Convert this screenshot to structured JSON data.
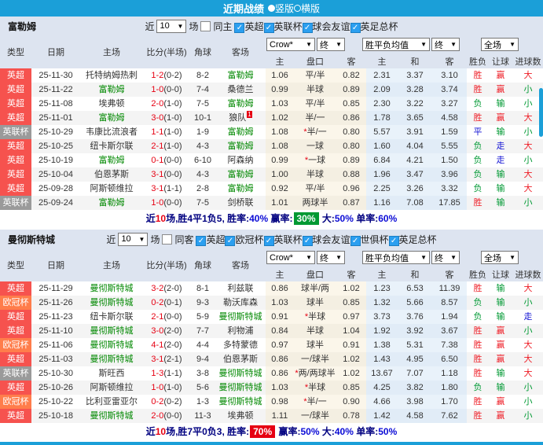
{
  "titlebar": {
    "title": "近期战绩",
    "layout_options": [
      {
        "label": "竖版",
        "selected": true
      },
      {
        "label": "横版",
        "selected": false
      }
    ]
  },
  "table_headers": {
    "type": "类型",
    "date": "日期",
    "home": "主场",
    "score": "比分(半场)",
    "corner": "角球",
    "away": "客场",
    "odds_home": "主",
    "odds_handicap": "盘口",
    "odds_away": "客",
    "avg_home": "主",
    "avg_draw": "和",
    "avg_away": "客",
    "result": "胜负",
    "handicap_result": "让球",
    "goals_result": "进球数"
  },
  "type_colors": {
    "英超": "#f6524e",
    "英联杯": "#9a9a9a",
    "欧冠杯": "#ff7d4b"
  },
  "result_colors": {
    "胜": "#ee1c25",
    "负": "#009933",
    "平": "#1414d4",
    "赢": "#ee1c25",
    "输": "#009933",
    "走": "#1414d4",
    "大": "#ee1c25",
    "小": "#009933"
  },
  "sections": [
    {
      "team": "富勒姆",
      "filter": {
        "near_label": "近",
        "count": "10",
        "games_label": "场",
        "venue_label": "同主",
        "venue_checked": false,
        "competitions": [
          "英超",
          "英联杯",
          "球会友谊",
          "英足总杯"
        ]
      },
      "dropdowns": {
        "odds_source": "Crow*",
        "odds_stage": "终",
        "avg_label": "胜平负均值",
        "avg_stage": "终",
        "scope": "全场"
      },
      "rows": [
        {
          "type": "英超",
          "date": "25-11-30",
          "home": "托特纳姆热刺",
          "home_focus": false,
          "score": "1-2",
          "half": "(0-2)",
          "corner": "8-2",
          "away": "富勒姆",
          "away_focus": true,
          "o1": "1.06",
          "pk": "平/半",
          "pk_star": false,
          "o2": "0.82",
          "a1": "2.31",
          "a2": "3.37",
          "a3": "3.10",
          "r1": "胜",
          "r2": "赢",
          "r3": "大"
        },
        {
          "type": "英超",
          "date": "25-11-22",
          "home": "富勒姆",
          "home_focus": true,
          "score": "1-0",
          "half": "(0-0)",
          "corner": "7-4",
          "away": "桑德兰",
          "away_focus": false,
          "o1": "0.99",
          "pk": "半球",
          "pk_star": false,
          "o2": "0.89",
          "a1": "2.09",
          "a2": "3.28",
          "a3": "3.74",
          "r1": "胜",
          "r2": "赢",
          "r3": "小"
        },
        {
          "type": "英超",
          "date": "25-11-08",
          "home": "埃弗顿",
          "home_focus": false,
          "score": "2-0",
          "half": "(1-0)",
          "corner": "7-5",
          "away": "富勒姆",
          "away_focus": true,
          "o1": "1.03",
          "pk": "平/半",
          "pk_star": false,
          "o2": "0.85",
          "a1": "2.30",
          "a2": "3.22",
          "a3": "3.27",
          "r1": "负",
          "r2": "输",
          "r3": "小"
        },
        {
          "type": "英超",
          "date": "25-11-01",
          "home": "富勒姆",
          "home_focus": true,
          "score": "3-0",
          "half": "(1-0)",
          "corner": "10-1",
          "away": "狼队",
          "away_focus": false,
          "away_redcard": "1",
          "o1": "1.02",
          "pk": "半/一",
          "pk_star": false,
          "o2": "0.86",
          "a1": "1.78",
          "a2": "3.65",
          "a3": "4.58",
          "r1": "胜",
          "r2": "赢",
          "r3": "大"
        },
        {
          "type": "英联杯",
          "date": "25-10-29",
          "home": "韦康比流浪者",
          "home_focus": false,
          "score": "1-1",
          "half": "(1-0)",
          "corner": "1-9",
          "away": "富勒姆",
          "away_focus": true,
          "o1": "1.08",
          "pk": "半/一",
          "pk_star": true,
          "o2": "0.80",
          "a1": "5.57",
          "a2": "3.91",
          "a3": "1.59",
          "r1": "平",
          "r2": "输",
          "r3": "小"
        },
        {
          "type": "英超",
          "date": "25-10-25",
          "home": "纽卡斯尔联",
          "home_focus": false,
          "score": "2-1",
          "half": "(1-0)",
          "corner": "4-3",
          "away": "富勒姆",
          "away_focus": true,
          "o1": "1.08",
          "pk": "一球",
          "pk_star": false,
          "o2": "0.80",
          "a1": "1.60",
          "a2": "4.04",
          "a3": "5.55",
          "r1": "负",
          "r2": "走",
          "r3": "大"
        },
        {
          "type": "英超",
          "date": "25-10-19",
          "home": "富勒姆",
          "home_focus": true,
          "score": "0-1",
          "half": "(0-0)",
          "corner": "6-10",
          "away": "阿森纳",
          "away_focus": false,
          "o1": "0.99",
          "pk": "一球",
          "pk_star": true,
          "o2": "0.89",
          "a1": "6.84",
          "a2": "4.21",
          "a3": "1.50",
          "r1": "负",
          "r2": "走",
          "r3": "小"
        },
        {
          "type": "英超",
          "date": "25-10-04",
          "home": "伯恩茅斯",
          "home_focus": false,
          "score": "3-1",
          "half": "(0-0)",
          "corner": "4-3",
          "away": "富勒姆",
          "away_focus": true,
          "o1": "1.00",
          "pk": "半球",
          "pk_star": false,
          "o2": "0.88",
          "a1": "1.96",
          "a2": "3.47",
          "a3": "3.96",
          "r1": "负",
          "r2": "输",
          "r3": "大"
        },
        {
          "type": "英超",
          "date": "25-09-28",
          "home": "阿斯顿维拉",
          "home_focus": false,
          "score": "3-1",
          "half": "(1-1)",
          "corner": "2-8",
          "away": "富勒姆",
          "away_focus": true,
          "o1": "0.92",
          "pk": "平/半",
          "pk_star": false,
          "o2": "0.96",
          "a1": "2.25",
          "a2": "3.26",
          "a3": "3.32",
          "r1": "负",
          "r2": "输",
          "r3": "大"
        },
        {
          "type": "英联杯",
          "date": "25-09-24",
          "home": "富勒姆",
          "home_focus": true,
          "score": "1-0",
          "half": "(0-0)",
          "corner": "7-5",
          "away": "剑桥联",
          "away_focus": false,
          "o1": "1.01",
          "pk": "两球半",
          "pk_star": false,
          "o2": "0.87",
          "a1": "1.16",
          "a2": "7.08",
          "a3": "17.85",
          "r1": "胜",
          "r2": "输",
          "r3": "小"
        }
      ],
      "summary": {
        "lead": "近",
        "count": "10",
        "tail": "场,胜4平1负5, 胜率:",
        "items": [
          {
            "label": "",
            "value": "40%",
            "style": "blue"
          },
          {
            "label": " 赢率:",
            "value": "30%",
            "style": "green-bg"
          },
          {
            "label": " 大:",
            "value": "50%",
            "style": "blue"
          },
          {
            "label": " 单率:",
            "value": "60%",
            "style": "blue"
          }
        ]
      }
    },
    {
      "team": "曼彻斯特城",
      "filter": {
        "near_label": "近",
        "count": "10",
        "games_label": "场",
        "venue_label": "同客",
        "venue_checked": false,
        "competitions": [
          "英超",
          "欧冠杯",
          "英联杯",
          "球会友谊",
          "世俱杯",
          "英足总杯"
        ]
      },
      "dropdowns": {
        "odds_source": "Crow*",
        "odds_stage": "终",
        "avg_label": "胜平负均值",
        "avg_stage": "终",
        "scope": "全场"
      },
      "rows": [
        {
          "type": "英超",
          "date": "25-11-29",
          "home": "曼彻斯特城",
          "home_focus": true,
          "score": "3-2",
          "half": "(2-0)",
          "corner": "8-1",
          "away": "利兹联",
          "away_focus": false,
          "o1": "0.86",
          "pk": "球半/两",
          "pk_star": false,
          "o2": "1.02",
          "a1": "1.23",
          "a2": "6.53",
          "a3": "11.39",
          "r1": "胜",
          "r2": "输",
          "r3": "大"
        },
        {
          "type": "欧冠杯",
          "date": "25-11-26",
          "home": "曼彻斯特城",
          "home_focus": true,
          "score": "0-2",
          "half": "(0-1)",
          "corner": "9-3",
          "away": "勒沃库森",
          "away_focus": false,
          "o1": "1.03",
          "pk": "球半",
          "pk_star": false,
          "o2": "0.85",
          "a1": "1.32",
          "a2": "5.66",
          "a3": "8.57",
          "r1": "负",
          "r2": "输",
          "r3": "小"
        },
        {
          "type": "英超",
          "date": "25-11-23",
          "home": "纽卡斯尔联",
          "home_focus": false,
          "score": "2-1",
          "half": "(0-0)",
          "corner": "5-9",
          "away": "曼彻斯特城",
          "away_focus": true,
          "o1": "0.91",
          "pk": "半球",
          "pk_star": true,
          "o2": "0.97",
          "a1": "3.73",
          "a2": "3.76",
          "a3": "1.94",
          "r1": "负",
          "r2": "输",
          "r3": "走"
        },
        {
          "type": "英超",
          "date": "25-11-10",
          "home": "曼彻斯特城",
          "home_focus": true,
          "score": "3-0",
          "half": "(2-0)",
          "corner": "7-7",
          "away": "利物浦",
          "away_focus": false,
          "o1": "0.84",
          "pk": "半球",
          "pk_star": false,
          "o2": "1.04",
          "a1": "1.92",
          "a2": "3.92",
          "a3": "3.67",
          "r1": "胜",
          "r2": "赢",
          "r3": "小"
        },
        {
          "type": "欧冠杯",
          "date": "25-11-06",
          "home": "曼彻斯特城",
          "home_focus": true,
          "score": "4-1",
          "half": "(2-0)",
          "corner": "4-4",
          "away": "多特蒙德",
          "away_focus": false,
          "o1": "0.97",
          "pk": "球半",
          "pk_star": false,
          "o2": "0.91",
          "a1": "1.38",
          "a2": "5.31",
          "a3": "7.38",
          "r1": "胜",
          "r2": "赢",
          "r3": "大"
        },
        {
          "type": "英超",
          "date": "25-11-03",
          "home": "曼彻斯特城",
          "home_focus": true,
          "score": "3-1",
          "half": "(2-1)",
          "corner": "9-4",
          "away": "伯恩茅斯",
          "away_focus": false,
          "o1": "0.86",
          "pk": "一/球半",
          "pk_star": false,
          "o2": "1.02",
          "a1": "1.43",
          "a2": "4.95",
          "a3": "6.50",
          "r1": "胜",
          "r2": "赢",
          "r3": "大"
        },
        {
          "type": "英联杯",
          "date": "25-10-30",
          "home": "斯旺西",
          "home_focus": false,
          "score": "1-3",
          "half": "(1-1)",
          "corner": "3-8",
          "away": "曼彻斯特城",
          "away_focus": true,
          "o1": "0.86",
          "pk": "两/两球半",
          "pk_star": true,
          "o2": "1.02",
          "a1": "13.67",
          "a2": "7.07",
          "a3": "1.18",
          "r1": "胜",
          "r2": "输",
          "r3": "大"
        },
        {
          "type": "英超",
          "date": "25-10-26",
          "home": "阿斯顿维拉",
          "home_focus": false,
          "score": "1-0",
          "half": "(1-0)",
          "corner": "5-6",
          "away": "曼彻斯特城",
          "away_focus": true,
          "o1": "1.03",
          "pk": "半球",
          "pk_star": true,
          "o2": "0.85",
          "a1": "4.25",
          "a2": "3.82",
          "a3": "1.80",
          "r1": "负",
          "r2": "输",
          "r3": "小"
        },
        {
          "type": "欧冠杯",
          "date": "25-10-22",
          "home": "比利亚雷亚尔",
          "home_focus": false,
          "score": "0-2",
          "half": "(0-2)",
          "corner": "1-3",
          "away": "曼彻斯特城",
          "away_focus": true,
          "o1": "0.98",
          "pk": "半/一",
          "pk_star": true,
          "o2": "0.90",
          "a1": "4.66",
          "a2": "3.98",
          "a3": "1.70",
          "r1": "胜",
          "r2": "赢",
          "r3": "小"
        },
        {
          "type": "英超",
          "date": "25-10-18",
          "home": "曼彻斯特城",
          "home_focus": true,
          "score": "2-0",
          "half": "(0-0)",
          "corner": "11-3",
          "away": "埃弗顿",
          "away_focus": false,
          "o1": "1.11",
          "pk": "一/球半",
          "pk_star": false,
          "o2": "0.78",
          "a1": "1.42",
          "a2": "4.58",
          "a3": "7.62",
          "r1": "胜",
          "r2": "赢",
          "r3": "小"
        }
      ],
      "summary": {
        "lead": "近",
        "count": "10",
        "tail": "场,胜7平0负3, 胜率:",
        "items": [
          {
            "label": "",
            "value": "70%",
            "style": "red-bg"
          },
          {
            "label": " 赢率:",
            "value": "50%",
            "style": "blue"
          },
          {
            "label": " 大:",
            "value": "40%",
            "style": "blue"
          },
          {
            "label": " 单率:",
            "value": "50%",
            "style": "blue"
          }
        ]
      }
    }
  ]
}
